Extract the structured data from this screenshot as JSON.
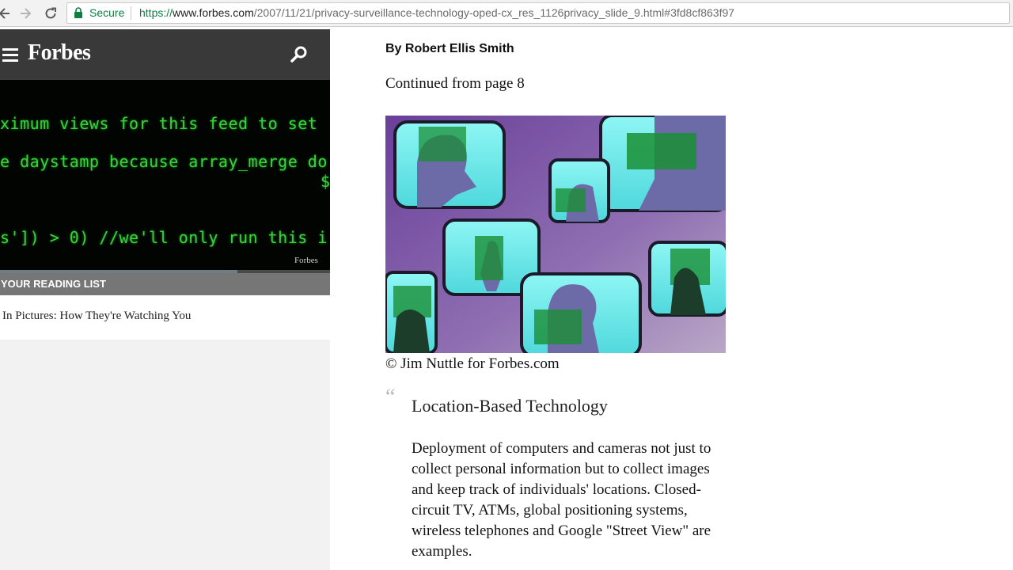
{
  "browser": {
    "security_label": "Secure",
    "url_scheme": "https://",
    "url_host": "www.forbes.com",
    "url_path": "/2007/11/21/privacy-surveillance-technology-oped-cx_res_1126privacy_slide_9.html#3fd8cf863f97",
    "secure_color": "#0b8043"
  },
  "site": {
    "logo": "Forbes"
  },
  "hero": {
    "code_lines": [
      "ximum views for this feed to set",
      "e daystamp because array_merge do",
      "$",
      "s']) > 0) //we'll only run this i"
    ],
    "watermark": "Forbes",
    "progress_fraction": 0.72
  },
  "reading_list": {
    "title": "YOUR READING LIST",
    "items": [
      "In Pictures: How They're Watching You"
    ]
  },
  "article": {
    "byline": "By Robert Ellis Smith",
    "continued": "Continued from page 8",
    "image_credit": "© Jim Nuttle for Forbes.com",
    "quote_mark": "“",
    "section_heading": "Location-Based Technology",
    "body": "Deployment of computers and cameras not just to collect personal information but to collect images and keep track of individuals' locations. Closed-circuit TV, ATMs, global positioning systems, wireless telephones and Google \"Street View\" are examples."
  }
}
